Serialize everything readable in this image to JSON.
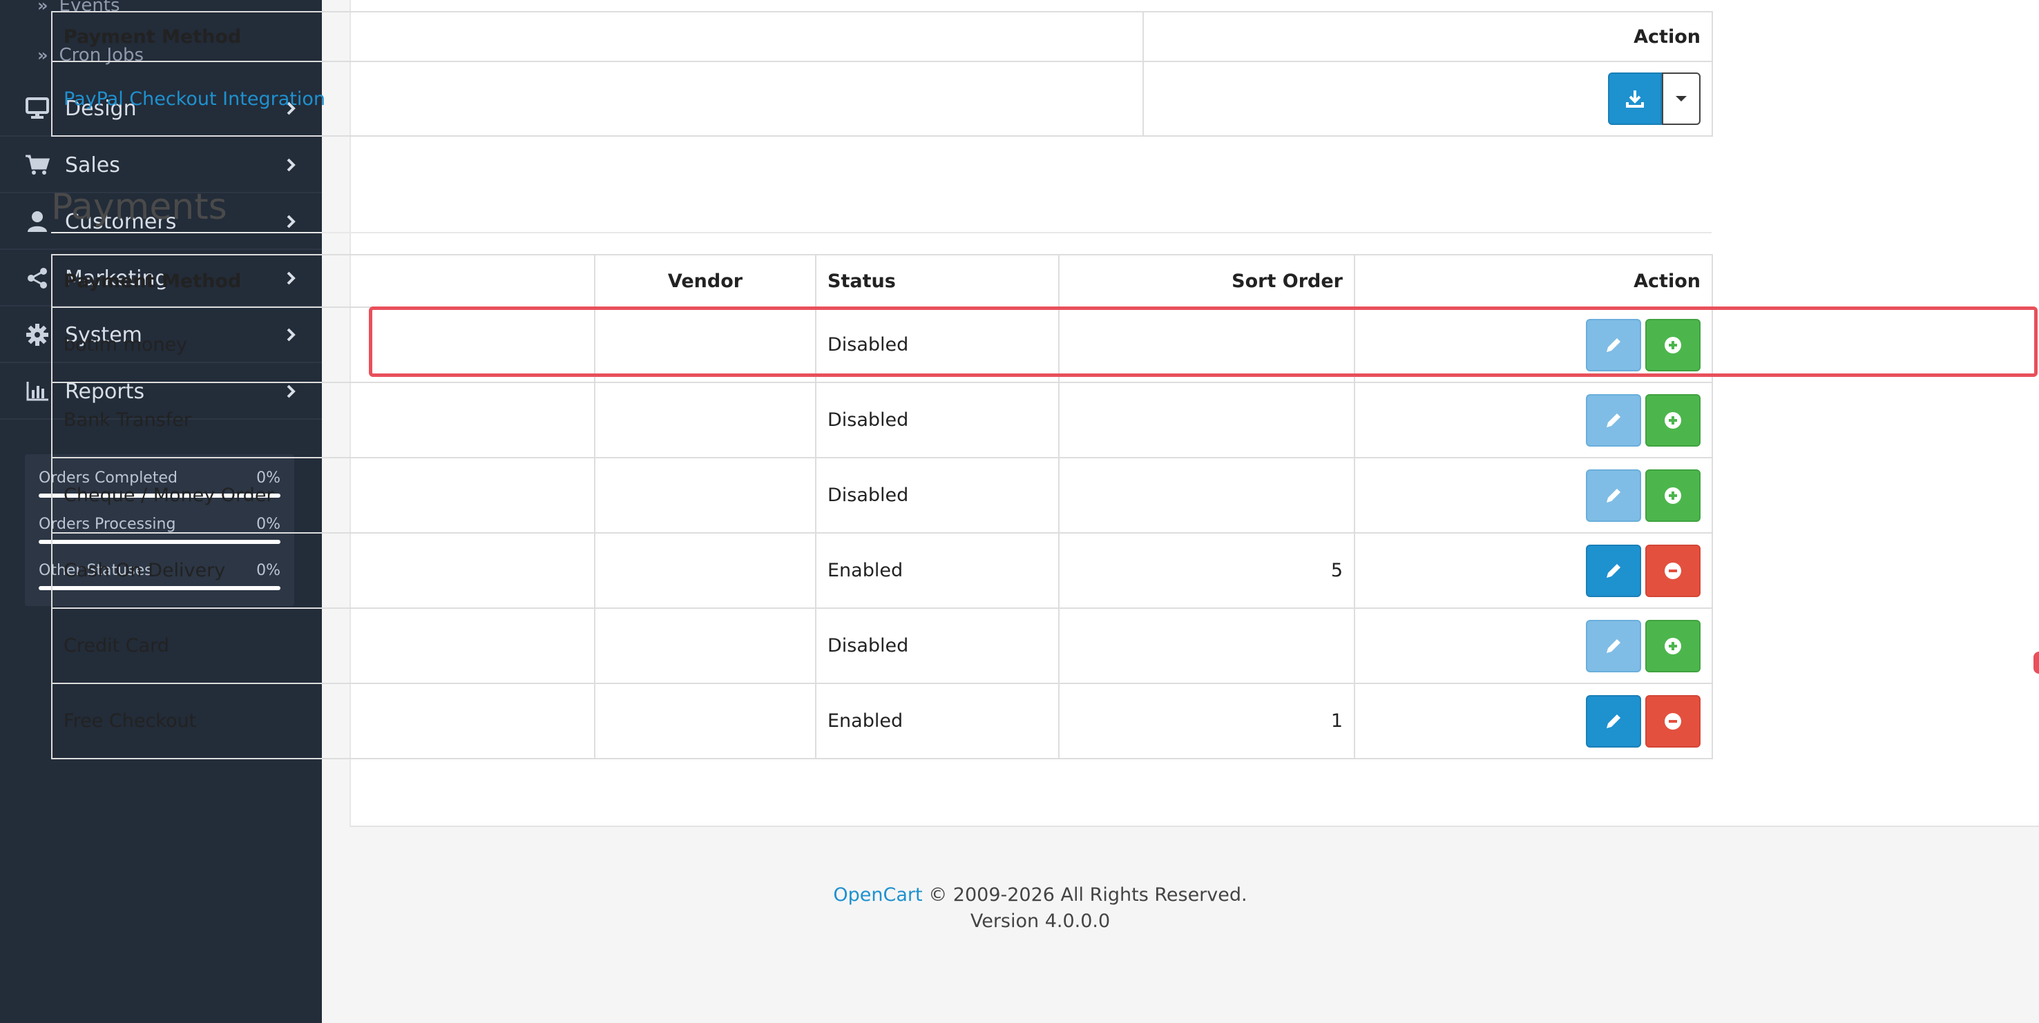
{
  "sidebar": {
    "sub_items": [
      {
        "label": "Events"
      },
      {
        "label": "Cron Jobs"
      }
    ],
    "items": [
      {
        "label": "Design",
        "icon": "monitor-icon"
      },
      {
        "label": "Sales",
        "icon": "cart-icon"
      },
      {
        "label": "Customers",
        "icon": "user-icon"
      },
      {
        "label": "Marketing",
        "icon": "share-icon"
      },
      {
        "label": "System",
        "icon": "gear-icon"
      },
      {
        "label": "Reports",
        "icon": "bar-chart-icon"
      }
    ],
    "stats": [
      {
        "label": "Orders Completed",
        "value": "0%",
        "fraction": 0
      },
      {
        "label": "Orders Processing",
        "value": "0%",
        "fraction": 0
      },
      {
        "label": "Other Statuses",
        "value": "0%",
        "fraction": 0
      }
    ]
  },
  "extensions_table": {
    "headers": {
      "method": "Payment Method",
      "action": "Action"
    },
    "rows": [
      {
        "method": "PayPal Checkout Integration"
      }
    ]
  },
  "payments": {
    "title": "Payments",
    "headers": {
      "method": "Payment Method",
      "vendor": "Vendor",
      "status": "Status",
      "sort_order": "Sort Order",
      "action": "Action"
    },
    "rows": [
      {
        "method": "botim money",
        "vendor": "",
        "status": "Disabled",
        "sort_order": "",
        "enabled": false
      },
      {
        "method": "Bank Transfer",
        "vendor": "",
        "status": "Disabled",
        "sort_order": "",
        "enabled": false
      },
      {
        "method": "Cheque / Money Order",
        "vendor": "",
        "status": "Disabled",
        "sort_order": "",
        "enabled": false
      },
      {
        "method": "Cash On Delivery",
        "vendor": "",
        "status": "Enabled",
        "sort_order": "5",
        "enabled": true
      },
      {
        "method": "Credit Card",
        "vendor": "",
        "status": "Disabled",
        "sort_order": "",
        "enabled": false
      },
      {
        "method": "Free Checkout",
        "vendor": "",
        "status": "Enabled",
        "sort_order": "1",
        "enabled": true
      }
    ]
  },
  "footer": {
    "brand": "OpenCart",
    "copyright": "© 2009-2026 All Rights Reserved.",
    "version": "Version 4.0.0.0"
  },
  "colors": {
    "sidebar_bg": "#232c39",
    "link": "#1e91cf",
    "install_green": "#4cb64c",
    "uninstall_red": "#e3503e",
    "highlight": "#e8505b"
  }
}
